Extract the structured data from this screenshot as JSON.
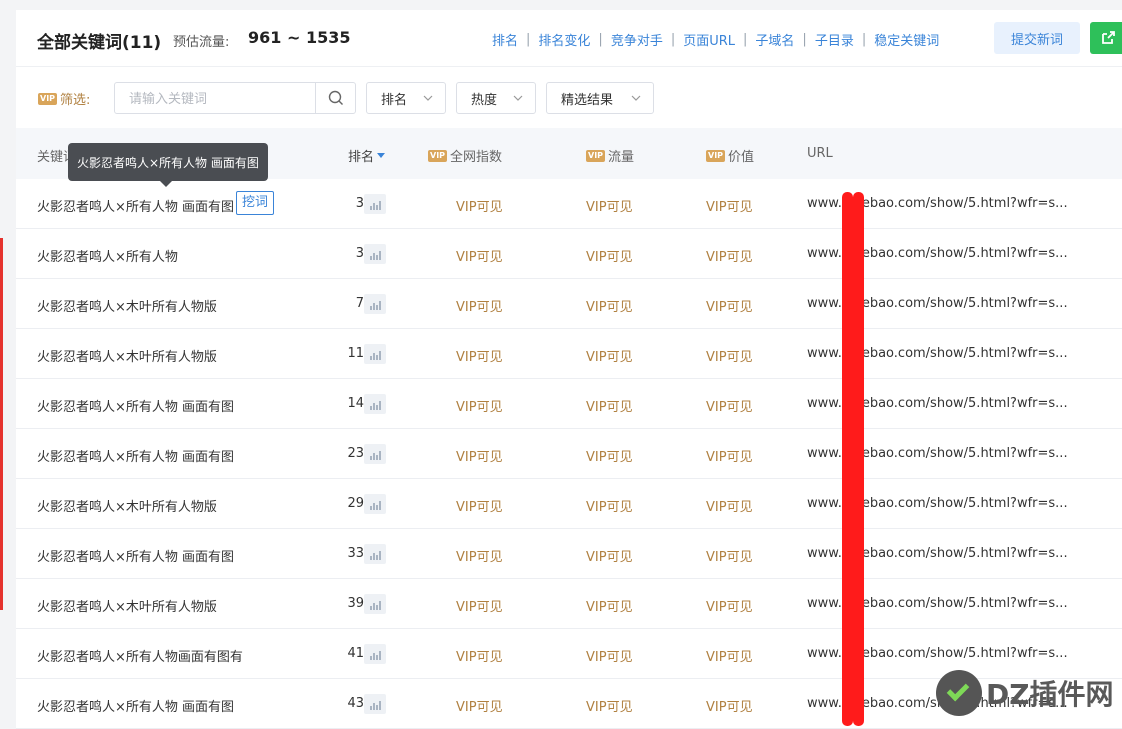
{
  "header": {
    "title": "全部关键词(11)",
    "flow_label": "预估流量:",
    "flow_value": "961 ~ 1535",
    "links": [
      "排名",
      "排名变化",
      "竞争对手",
      "页面URL",
      "子域名",
      "子目录",
      "稳定关键词"
    ],
    "submit_label": "提交新词"
  },
  "filter": {
    "vip_badge": "VIP",
    "label": "筛选:",
    "search_placeholder": "请输入关键词",
    "dropdowns": [
      "排名",
      "热度",
      "精选结果"
    ]
  },
  "table": {
    "columns": {
      "keyword": "关键词",
      "rank": "排名",
      "index": "全网指数",
      "flow": "流量",
      "value": "价值",
      "url": "URL"
    },
    "dig_label": "挖词",
    "vip_value": "VIP可见",
    "rows": [
      {
        "keyword": "火影忍者鸣人×所有人物 画面有图",
        "rank": "3",
        "url": "www.",
        "url_tail": "ebao.com/show/5.html?wfr=s..."
      },
      {
        "keyword": "火影忍者鸣人×所有人物",
        "rank": "3",
        "url": "www.",
        "url_tail": "ebao.com/show/5.html?wfr=s..."
      },
      {
        "keyword": "火影忍者鸣人×木叶所有人物版",
        "rank": "7",
        "url": "www.",
        "url_tail": "ebao.com/show/5.html?wfr=s..."
      },
      {
        "keyword": "火影忍者鸣人×木叶所有人物版",
        "rank": "11",
        "url": "www.",
        "url_tail": "ebao.com/show/5.html?wfr=s..."
      },
      {
        "keyword": "火影忍者鸣人×所有人物 画面有图",
        "rank": "14",
        "url": "www.",
        "url_tail": "ebao.com/show/5.html?wfr=s..."
      },
      {
        "keyword": "火影忍者鸣人×所有人物 画面有图",
        "rank": "23",
        "url": "www.",
        "url_tail": "ebao.com/show/5.html?wfr=s..."
      },
      {
        "keyword": "火影忍者鸣人×木叶所有人物版",
        "rank": "29",
        "url": "www.",
        "url_tail": "ebao.com/show/5.html?wfr=s..."
      },
      {
        "keyword": "火影忍者鸣人×所有人物 画面有图",
        "rank": "33",
        "url": "www.",
        "url_tail": "ebao.com/show/5.html?wfr=s..."
      },
      {
        "keyword": "火影忍者鸣人×木叶所有人物版",
        "rank": "39",
        "url": "www.",
        "url_tail": "ebao.com/show/5.html?wfr=s..."
      },
      {
        "keyword": "火影忍者鸣人×所有人物画面有图有",
        "rank": "41",
        "url": "www.",
        "url_tail": "ebao.com/show/5.html?wfr=s..."
      },
      {
        "keyword": "火影忍者鸣人×所有人物 画面有图",
        "rank": "43",
        "url": "www.",
        "url_tail": "ebao.com/show/5.html?wfr=s..."
      }
    ]
  },
  "tooltip": "火影忍者鸣人×所有人物 画面有图",
  "watermark": "DZ插件网",
  "colors": {
    "accent_blue": "#3a84d8",
    "vip_gold": "#b08040",
    "export_green": "#2ec05a",
    "redaction_red": "#ff1b1b"
  }
}
